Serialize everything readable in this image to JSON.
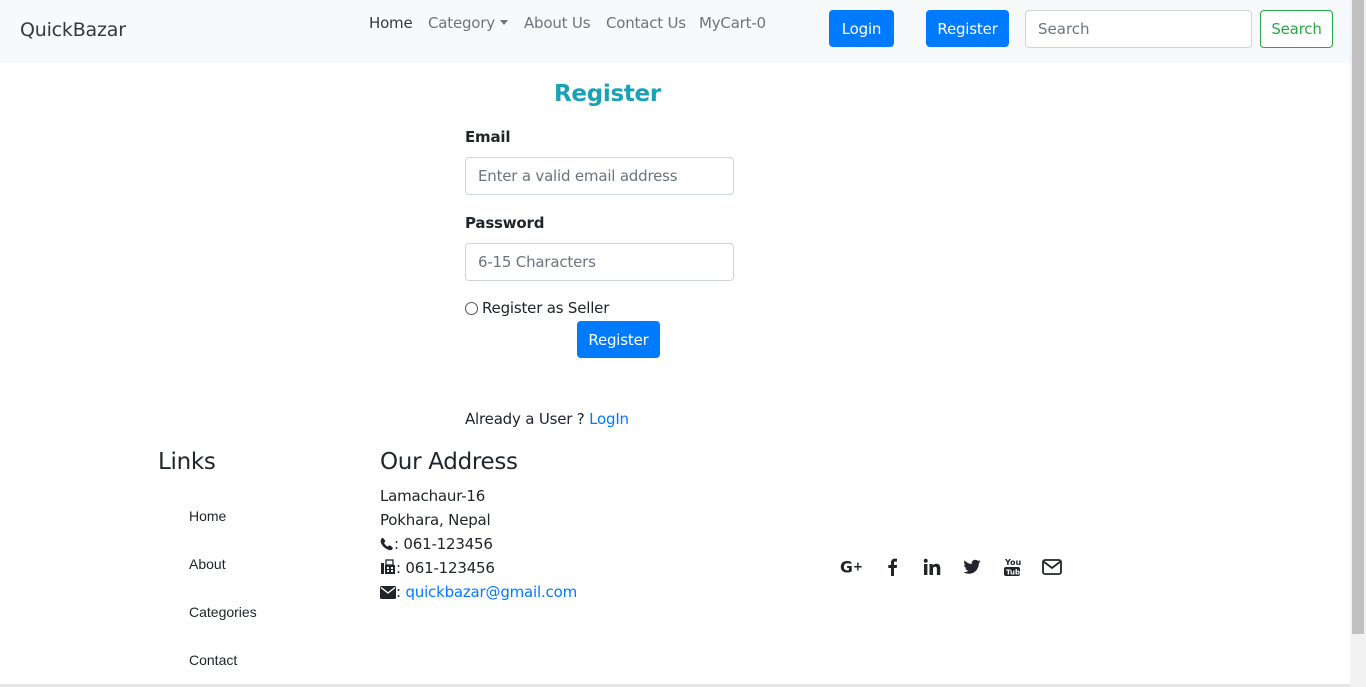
{
  "navbar": {
    "brand": "QuickBazar",
    "links": [
      {
        "label": "Home",
        "active": true
      },
      {
        "label": "Category"
      },
      {
        "label": "About Us"
      },
      {
        "label": "Contact Us"
      },
      {
        "label": "MyCart-0"
      }
    ],
    "login_label": "Login",
    "register_label": "Register",
    "search_placeholder": "Search",
    "search_button": "Search"
  },
  "form": {
    "title": "Register",
    "email_label": "Email",
    "email_placeholder": "Enter a valid email address",
    "password_label": "Password",
    "password_placeholder": "6-15 Characters",
    "seller_label": "Register as Seller",
    "seller_checked": false,
    "submit_label": "Register",
    "already_text": "Already a User ?",
    "login_link": "LogIn"
  },
  "footer": {
    "links_heading": "Links",
    "links": [
      "Home",
      "About",
      "Categories",
      "Contact"
    ],
    "address_heading": "Our Address",
    "address_line1": "Lamachaur-16",
    "address_line2": "Pokhara, Nepal",
    "phone": ": 061-123456",
    "fax": ": 061-123456",
    "email_prefix": ":",
    "email": "quickbazar@gmail.com",
    "social_icons": [
      "google-plus-icon",
      "facebook-icon",
      "linkedin-icon",
      "twitter-icon",
      "youtube-icon",
      "envelope-icon"
    ]
  },
  "colors": {
    "primary": "#007bff",
    "success": "#28a745",
    "info": "#17a2b8",
    "navbar_bg": "#f8f9fa"
  }
}
